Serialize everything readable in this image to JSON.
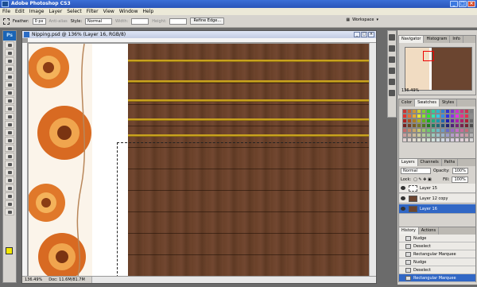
{
  "app": {
    "title": "Adobe Photoshop CS3"
  },
  "menu": [
    "File",
    "Edit",
    "Image",
    "Layer",
    "Select",
    "Filter",
    "View",
    "Window",
    "Help"
  ],
  "options": {
    "feather_label": "Feather:",
    "feather_value": "0 px",
    "antialias_label": "Anti-alias",
    "style_label": "Style:",
    "style_value": "Normal",
    "width_label": "Width:",
    "height_label": "Height:",
    "refine_edge": "Refine Edge...",
    "workspace": "Workspace"
  },
  "document": {
    "title": "Nipping.psd @ 136% (Layer 16, RGB/8)",
    "zoom": "136.49%",
    "doc_info": "Doc: 11.6M/81.7M"
  },
  "navigator": {
    "tabs": [
      "Navigator",
      "Histogram",
      "Info"
    ],
    "zoom": "136.49%"
  },
  "color_panel": {
    "tabs": [
      "Color",
      "Swatches",
      "Styles"
    ]
  },
  "layers_panel": {
    "tabs": [
      "Layers",
      "Channels",
      "Paths"
    ],
    "blend_mode": "Normal",
    "opacity_label": "Opacity:",
    "opacity_value": "100%",
    "lock_label": "Lock:",
    "fill_label": "Fill:",
    "fill_value": "100%",
    "layers": [
      {
        "name": "Layer 15",
        "selected": false
      },
      {
        "name": "Layer 12 copy",
        "selected": false
      },
      {
        "name": "Layer 16",
        "selected": true
      }
    ]
  },
  "history_panel": {
    "tabs": [
      "History",
      "Actions"
    ],
    "items": [
      "Nudge",
      "Deselect",
      "Rectangular Marquee",
      "Nudge",
      "Deselect",
      "Rectangular Marquee"
    ]
  },
  "colors": {
    "foreground": "#f3e800",
    "background": "#ffffff",
    "wood": "#6a4129",
    "stripe": "#c9a21f",
    "selection": "#3167c5"
  },
  "icons": [
    "ps-logo-icon",
    "marquee-icon",
    "eye-icon",
    "layer-thumb-icon"
  ]
}
